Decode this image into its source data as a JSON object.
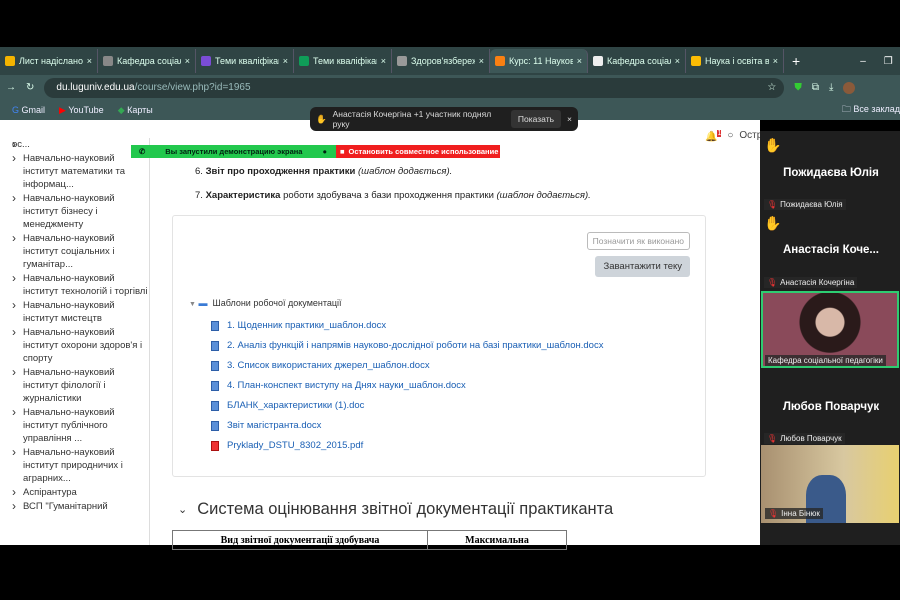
{
  "browser": {
    "tabs": [
      {
        "label": "Лист надіслано",
        "color": "#f4b400"
      },
      {
        "label": "Кафедра соціал",
        "color": "#888"
      },
      {
        "label": "Теми кваліфікац",
        "color": "#7b4dd6"
      },
      {
        "label": "Теми кваліфікац",
        "color": "#0f9d58"
      },
      {
        "label": "Здоров'язбереж",
        "color": "#999"
      },
      {
        "label": "Курс: 11 Науков",
        "color": "#f98012"
      },
      {
        "label": "Кафедра соціал",
        "color": "#eee"
      },
      {
        "label": "Наука і освіта в",
        "color": "#fbbc04"
      }
    ],
    "url_host": "du.luguniv.edu.ua",
    "url_path": "/course/view.php?id=1965",
    "bookmarks": [
      "Gmail",
      "YouTube",
      "Карты"
    ],
    "all_bookmarks": "Все заклад"
  },
  "notification": {
    "text": "Анастасія Кочергіна +1 участник поднял руку",
    "button": "Показать"
  },
  "share": {
    "status": "Вы запустили демонстрацию экрана",
    "stop": "Остановить совместное использование"
  },
  "header": {
    "user": "Островська",
    "badge": "1"
  },
  "sidebar": {
    "items": [
      "ос...",
      "Навчально-науковий інститут математики та інформац...",
      "Навчально-науковий інститут бізнесу і менеджменту",
      "Навчально-науковий інститут соціальних і гуманітар...",
      "Навчально-науковий інститут технологій і торгівлі",
      "Навчально-науковий інститут мистецтв",
      "Навчально-науковий інститут охорони здоров'я і спорту",
      "Навчально-науковий інститут філології і журналістики",
      "Навчально-науковий інститут публічного управління ...",
      "Навчально-науковий інститут природничих і аграрних...",
      "Аспірантура",
      "ВСП \"Гуманітарний"
    ]
  },
  "content": {
    "item6": {
      "num": "6.",
      "bold": "Звіт про проходження практики",
      "italic": "(шаблон додається)."
    },
    "item7": {
      "num": "7.",
      "bold": "Характеристика",
      "text": "роботи здобувача з бази проходження практики",
      "italic": "(шаблон додається)."
    },
    "mark_done": "Позначити як виконано",
    "download": "Завантажити теку",
    "folder": "Шаблони робочої документації",
    "files": [
      "1. Щоденник практики_шаблон.docx",
      "2. Аналіз функцій і напрямів науково-дослідної роботи на базі практики_шаблон.docx",
      "3. Список використаних джерел_шаблон.docx",
      "4. План-конспект виступу на Днях науки_шаблон.docx",
      "БЛАНК_характеристики (1).doc",
      "Звіт магістранта.docx",
      "Pryklady_DSTU_8302_2015.pdf"
    ],
    "section": "Система оцінювання звітної документації практиканта",
    "table_headers": [
      "Вид звітної документації здобувача",
      "Максимальна"
    ]
  },
  "participants": [
    {
      "name": "Пожидаєва Юлія",
      "label": "Пожидаєва Юлія"
    },
    {
      "name": "Анастасія Коче...",
      "label": "Анастасія Кочергіна"
    },
    {
      "label": "Кафедра соціальної педагогіки"
    },
    {
      "name": "Любов Поварчук",
      "label": "Любов Поварчук"
    },
    {
      "label": "Інна Бінюк"
    }
  ]
}
